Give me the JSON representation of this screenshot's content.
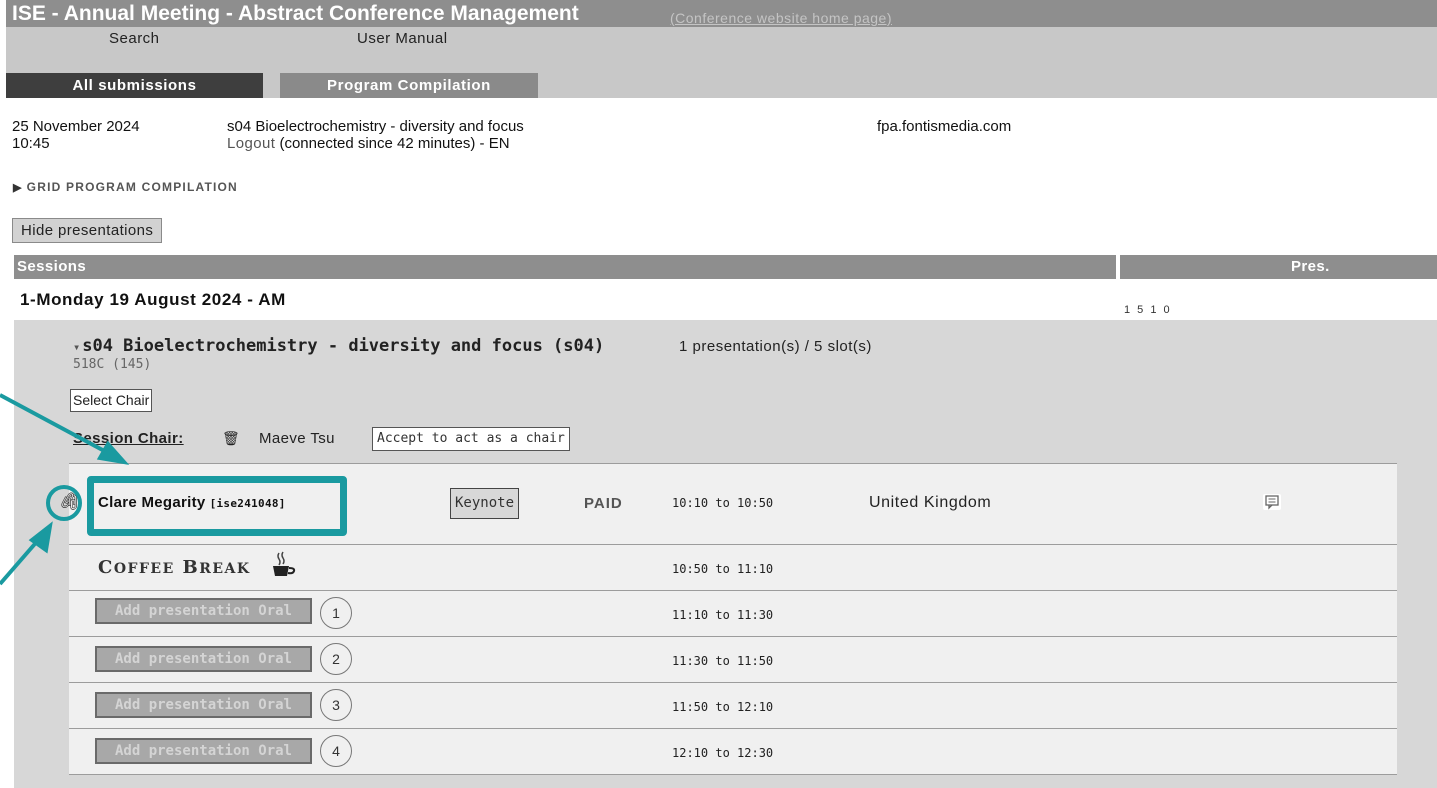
{
  "header": {
    "title": "ISE - Annual Meeting - Abstract Conference Management",
    "home_link": "(Conference website home page)"
  },
  "menu": {
    "search": "Search",
    "manual": "User Manual"
  },
  "tabs": {
    "all": "All submissions",
    "program": "Program Compilation"
  },
  "info": {
    "date": "25 November 2024",
    "time": "10:45",
    "session": "s04 Bioelectrochemistry - diversity and focus",
    "logout": "Logout",
    "connected": "(connected since 42 minutes) - EN",
    "host": "fpa.fontismedia.com"
  },
  "grid_toggle": "GRID PROGRAM COMPILATION",
  "hide_button": "Hide presentations",
  "table": {
    "col_sessions": "Sessions",
    "col_pres": "Pres."
  },
  "day": {
    "title": "1-Monday 19 August 2024 - AM",
    "counts": "1 5 1 0"
  },
  "session": {
    "title": "s04 Bioelectrochemistry - diversity and focus (s04)",
    "slots": "1 presentation(s) / 5 slot(s)",
    "room": "518C (145)",
    "select_chair": "Select Chair",
    "chair_label": "Session Chair:",
    "chair_name": "Maeve Tsu",
    "accept_chair": "Accept to act as a chair"
  },
  "presentation": {
    "name": "Clare Megarity",
    "id": "[ise241048]",
    "type": "Keynote",
    "status": "PAID",
    "time": "10:10 to 10:50",
    "country": "United Kingdom"
  },
  "coffee": {
    "label_c": "C",
    "label_rest1": "OFFEE",
    "label_b": "B",
    "label_rest2": "REAK",
    "time": "10:50 to 11:10"
  },
  "slots": [
    {
      "button": "Add presentation Oral",
      "num": "1",
      "time": "11:10 to 11:30"
    },
    {
      "button": "Add presentation Oral",
      "num": "2",
      "time": "11:30 to 11:50"
    },
    {
      "button": "Add presentation Oral",
      "num": "3",
      "time": "11:50 to 12:10"
    },
    {
      "button": "Add presentation Oral",
      "num": "4",
      "time": "12:10 to 12:30"
    }
  ],
  "colors": {
    "annotation": "#1a9aa0",
    "header_gray": "#8e8e8e",
    "active_tab": "#3e3e3e"
  }
}
